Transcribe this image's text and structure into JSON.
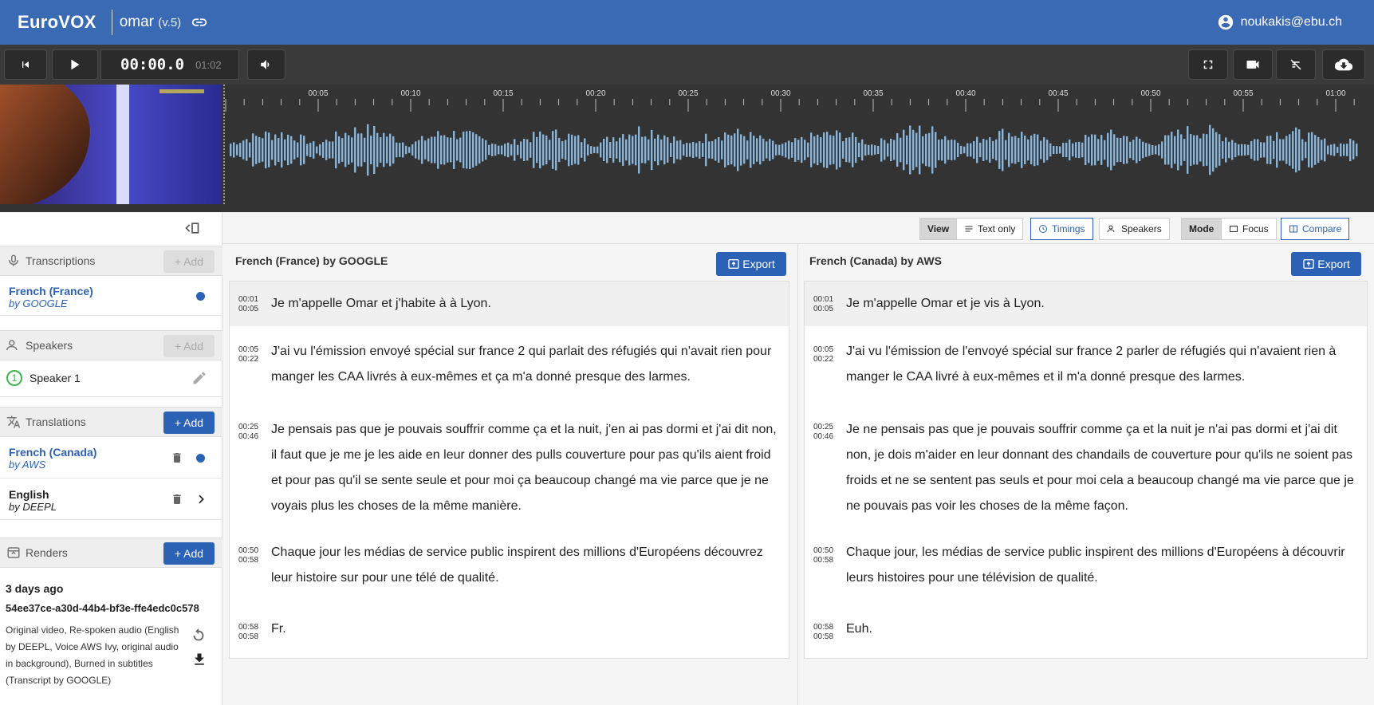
{
  "app": {
    "logo": "EuroVOX",
    "title": "omar",
    "version": "(v.5)",
    "user_email": "noukakis@ebu.ch"
  },
  "player": {
    "current_time": "00:00.0",
    "duration": "01:02"
  },
  "timeline": {
    "ticks": [
      "00:05",
      "00:10",
      "00:15",
      "00:20",
      "00:25",
      "00:30",
      "00:35",
      "00:40",
      "00:45",
      "00:50",
      "00:55",
      "01:00"
    ]
  },
  "viewbar": {
    "view_label": "View",
    "text_only": "Text only",
    "timings": "Timings",
    "speakers": "Speakers",
    "mode_label": "Mode",
    "focus": "Focus",
    "compare": "Compare"
  },
  "sidebar": {
    "transcriptions": {
      "title": "Transcriptions",
      "add": "+ Add",
      "items": [
        {
          "name": "French (France)",
          "by": "by GOOGLE"
        }
      ]
    },
    "speakers": {
      "title": "Speakers",
      "add": "+ Add",
      "items": [
        {
          "num": "1",
          "name": "Speaker 1"
        }
      ]
    },
    "translations": {
      "title": "Translations",
      "add": "+ Add",
      "items": [
        {
          "name": "French (Canada)",
          "by": "by AWS"
        },
        {
          "name": "English",
          "by": "by DEEPL"
        }
      ]
    },
    "renders": {
      "title": "Renders",
      "add": "+ Add",
      "age": "3 days ago",
      "id": "54ee37ce-a30d-44b4-bf3e-ffe4edc0c578",
      "description": "Original video, Re-spoken audio (English by DEEPL, Voice AWS Ivy, original audio in background), Burned in subtitles (Transcript by GOOGLE)"
    }
  },
  "left_panel": {
    "title": "French (France) by GOOGLE",
    "export": "Export",
    "segments": [
      {
        "start": "00:01",
        "end": "00:05",
        "text": "Je m'appelle Omar et j'habite à à Lyon."
      },
      {
        "start": "00:05",
        "end": "00:22",
        "text": "J'ai vu l'émission envoyé spécial sur france 2 qui parlait des réfugiés qui n'avait rien pour manger les CAA livrés à eux-mêmes et ça m'a donné presque des larmes."
      },
      {
        "start": "00:25",
        "end": "00:46",
        "text": "Je pensais pas que je pouvais souffrir comme ça et la nuit, j'en ai pas dormi et j'ai dit non, il faut que je me je les aide en leur donner des pulls couverture pour pas qu'ils aient froid et pour pas qu'il se sente seule et pour moi ça beaucoup changé ma vie parce que je ne voyais plus les choses de la même manière."
      },
      {
        "start": "00:50",
        "end": "00:58",
        "text": "Chaque jour les médias de service public inspirent des millions d'Européens découvrez leur histoire sur pour une télé de qualité."
      },
      {
        "start": "00:58",
        "end": "00:58",
        "text": "Fr."
      }
    ]
  },
  "right_panel": {
    "title": "French (Canada) by AWS",
    "export": "Export",
    "segments": [
      {
        "start": "00:01",
        "end": "00:05",
        "text": "Je m'appelle Omar et je vis à Lyon."
      },
      {
        "start": "00:05",
        "end": "00:22",
        "text": "J'ai vu l'émission de l'envoyé spécial sur france 2 parler de réfugiés qui n'avaient rien à manger le CAA livré à eux-mêmes et il m'a donné presque des larmes."
      },
      {
        "start": "00:25",
        "end": "00:46",
        "text": "Je ne pensais pas que je pouvais souffrir comme ça et la nuit je n'ai pas dormi et j'ai dit non, je dois m'aider en leur donnant des chandails de couverture pour qu'ils ne soient pas froids et ne se sentent pas seuls et pour moi cela a beaucoup changé ma vie parce que je ne pouvais pas voir les choses de la même façon."
      },
      {
        "start": "00:50",
        "end": "00:58",
        "text": "Chaque jour, les médias de service public inspirent des millions d'Européens à découvrir leurs histoires pour une télévision de qualité."
      },
      {
        "start": "00:58",
        "end": "00:58",
        "text": "Euh."
      }
    ]
  },
  "colors": {
    "brand": "#3a6ab4",
    "accent": "#2b62b5",
    "waveform": "#8fb3d3"
  }
}
